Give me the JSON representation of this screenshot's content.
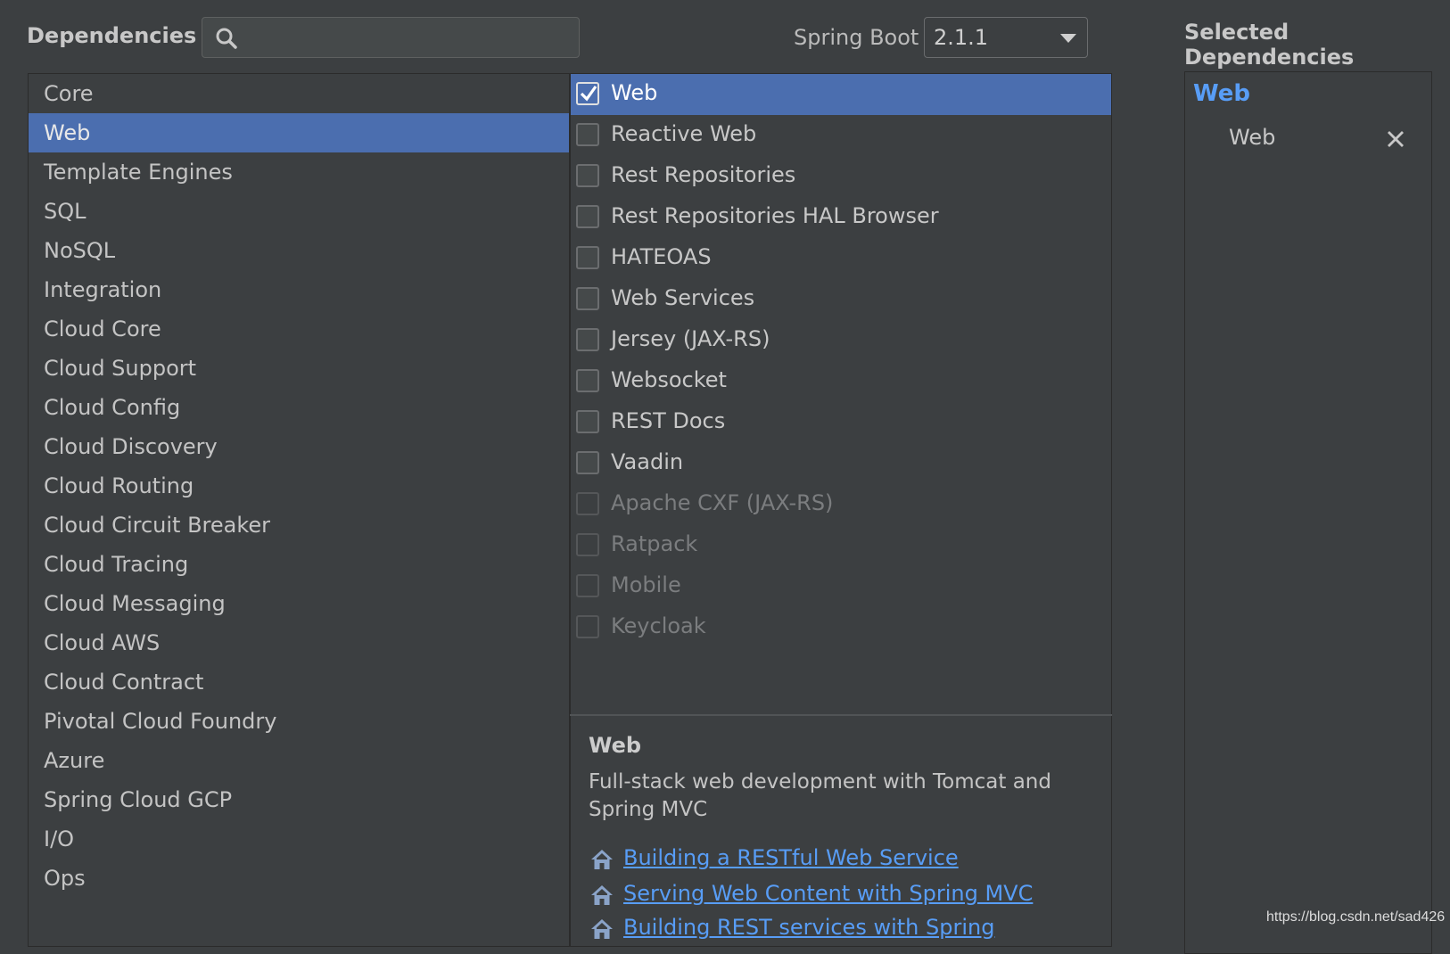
{
  "header": {
    "dependencies_label": "Dependencies",
    "search": {
      "value": "",
      "placeholder": ""
    },
    "spring_boot_label": "Spring Boot",
    "spring_boot_version": "2.1.1"
  },
  "categories": [
    {
      "label": "Core"
    },
    {
      "label": "Web",
      "selected": true
    },
    {
      "label": "Template Engines"
    },
    {
      "label": "SQL"
    },
    {
      "label": "NoSQL"
    },
    {
      "label": "Integration"
    },
    {
      "label": "Cloud Core"
    },
    {
      "label": "Cloud Support"
    },
    {
      "label": "Cloud Config"
    },
    {
      "label": "Cloud Discovery"
    },
    {
      "label": "Cloud Routing"
    },
    {
      "label": "Cloud Circuit Breaker"
    },
    {
      "label": "Cloud Tracing"
    },
    {
      "label": "Cloud Messaging"
    },
    {
      "label": "Cloud AWS"
    },
    {
      "label": "Cloud Contract"
    },
    {
      "label": "Pivotal Cloud Foundry"
    },
    {
      "label": "Azure"
    },
    {
      "label": "Spring Cloud GCP"
    },
    {
      "label": "I/O"
    },
    {
      "label": "Ops"
    }
  ],
  "dependencies": [
    {
      "label": "Web",
      "checked": true,
      "selected": true,
      "enabled": true
    },
    {
      "label": "Reactive Web",
      "checked": false,
      "enabled": true
    },
    {
      "label": "Rest Repositories",
      "checked": false,
      "enabled": true
    },
    {
      "label": "Rest Repositories HAL Browser",
      "checked": false,
      "enabled": true
    },
    {
      "label": "HATEOAS",
      "checked": false,
      "enabled": true
    },
    {
      "label": "Web Services",
      "checked": false,
      "enabled": true
    },
    {
      "label": "Jersey (JAX-RS)",
      "checked": false,
      "enabled": true
    },
    {
      "label": "Websocket",
      "checked": false,
      "enabled": true
    },
    {
      "label": "REST Docs",
      "checked": false,
      "enabled": true
    },
    {
      "label": "Vaadin",
      "checked": false,
      "enabled": true
    },
    {
      "label": "Apache CXF (JAX-RS)",
      "checked": false,
      "enabled": false
    },
    {
      "label": "Ratpack",
      "checked": false,
      "enabled": false
    },
    {
      "label": "Mobile",
      "checked": false,
      "enabled": false
    },
    {
      "label": "Keycloak",
      "checked": false,
      "enabled": false
    }
  ],
  "description": {
    "title": "Web",
    "text": "Full-stack web development with Tomcat and Spring MVC",
    "links": [
      {
        "label": "Building a RESTful Web Service",
        "icon": "home-icon"
      },
      {
        "label": "Serving Web Content with Spring MVC",
        "icon": "home-icon"
      },
      {
        "label": "Building REST services with Spring",
        "icon": "home-icon"
      }
    ]
  },
  "selected_panel": {
    "title": "Selected Dependencies",
    "groups": [
      {
        "name": "Web",
        "items": [
          {
            "label": "Web",
            "remove_icon": "close-icon"
          }
        ]
      }
    ]
  },
  "colors": {
    "background": "#3c3f41",
    "selection": "#4b6eaf",
    "link": "#589df6",
    "text": "#bbbbbb"
  },
  "watermark": "https://blog.csdn.net/sad426"
}
